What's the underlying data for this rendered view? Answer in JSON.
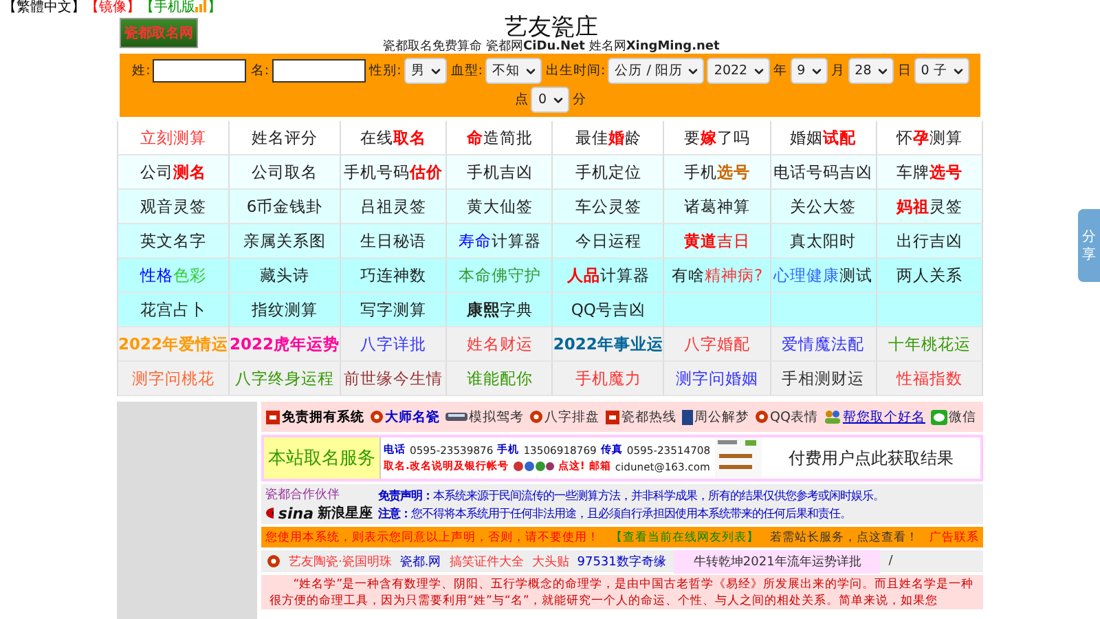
{
  "top_links": [
    {
      "text": "【繁體中文】",
      "color": "#000000"
    },
    {
      "text": "【镜像】",
      "color": "#ff0000"
    },
    {
      "text": "【手机版",
      "color": "#009900"
    },
    {
      "text": "】",
      "color": "#009900"
    }
  ],
  "logo": {
    "text": "瓷都取名网"
  },
  "header": {
    "title": "艺友瓷庄",
    "subtitle_parts": [
      {
        "text": "瓷都取名免费算命 瓷都网",
        "bold": false
      },
      {
        "text": "CiDu.Net",
        "bold": true
      },
      {
        "text": " 姓名网",
        "bold": false
      },
      {
        "text": "XingMing.net",
        "bold": true
      }
    ]
  },
  "form": {
    "fields": [
      {
        "kind": "input",
        "label": "姓:"
      },
      {
        "kind": "input",
        "label": "名:"
      },
      {
        "kind": "select",
        "label": "性别:",
        "value": "男"
      },
      {
        "kind": "select",
        "label": "血型:",
        "value": "不知"
      },
      {
        "kind": "select",
        "label": "出生时间:",
        "value": "公历 / 阳历"
      },
      {
        "kind": "select",
        "value": "2022"
      },
      {
        "kind": "unit",
        "label": "年"
      },
      {
        "kind": "select",
        "value": "9"
      },
      {
        "kind": "unit",
        "label": "月"
      },
      {
        "kind": "select",
        "value": "28"
      },
      {
        "kind": "unit",
        "label": "日"
      },
      {
        "kind": "select",
        "value": "0 子"
      }
    ],
    "second_row": [
      {
        "kind": "unit",
        "label": "点"
      },
      {
        "kind": "select",
        "value": "0"
      },
      {
        "kind": "unit",
        "label": "分"
      }
    ]
  },
  "grid": [
    [
      [
        {
          "text": "立刻测算",
          "color": "#ff3333"
        }
      ],
      [
        {
          "text": "姓名评分"
        }
      ],
      [
        {
          "text": "在线"
        },
        {
          "text": "取名",
          "color": "#ff0000",
          "bold": true
        }
      ],
      [
        {
          "text": "命",
          "color": "#ff0000",
          "bold": true
        },
        {
          "text": "造简批"
        }
      ],
      [
        {
          "text": "最佳"
        },
        {
          "text": "婚",
          "color": "#ff0000",
          "bold": true
        },
        {
          "text": "龄"
        }
      ],
      [
        {
          "text": "要"
        },
        {
          "text": "嫁",
          "color": "#ff0000",
          "bold": true
        },
        {
          "text": "了吗"
        }
      ],
      [
        {
          "text": "婚姻"
        },
        {
          "text": "试配",
          "color": "#ff0000",
          "bold": true
        }
      ],
      [
        {
          "text": "怀"
        },
        {
          "text": "孕",
          "color": "#ff0000",
          "bold": true
        },
        {
          "text": "测算"
        }
      ]
    ],
    [
      [
        {
          "text": "公司"
        },
        {
          "text": "测名",
          "color": "#ff0000",
          "bold": true
        }
      ],
      [
        {
          "text": "公司取名"
        }
      ],
      [
        {
          "text": "手机号码"
        },
        {
          "text": "估价",
          "color": "#ff0000",
          "bold": true
        }
      ],
      [
        {
          "text": "手机吉凶"
        }
      ],
      [
        {
          "text": "手机定位"
        }
      ],
      [
        {
          "text": "手机"
        },
        {
          "text": "选号",
          "color": "#cc6600",
          "bold": true
        }
      ],
      [
        {
          "text": "电话号码吉凶"
        }
      ],
      [
        {
          "text": "车牌"
        },
        {
          "text": "选号",
          "color": "#ff0000",
          "bold": true
        }
      ]
    ],
    [
      [
        {
          "text": "观音灵签"
        }
      ],
      [
        {
          "text": "6币金钱卦"
        }
      ],
      [
        {
          "text": "吕祖灵签"
        }
      ],
      [
        {
          "text": "黄大仙签"
        }
      ],
      [
        {
          "text": "车公灵签"
        }
      ],
      [
        {
          "text": "诸葛神算"
        }
      ],
      [
        {
          "text": "关公大签"
        }
      ],
      [
        {
          "text": "妈祖",
          "color": "#ff0000",
          "bold": true
        },
        {
          "text": "灵签"
        }
      ]
    ],
    [
      [
        {
          "text": "英文名字"
        }
      ],
      [
        {
          "text": "亲属关系图"
        }
      ],
      [
        {
          "text": "生日秘语"
        }
      ],
      [
        {
          "text": "寿命",
          "color": "#0000ff"
        },
        {
          "text": "计算器"
        }
      ],
      [
        {
          "text": "今日运程"
        }
      ],
      [
        {
          "text": "黄道",
          "color": "#ff0000",
          "bold": true
        },
        {
          "text": "吉日",
          "color": "#ff0000"
        }
      ],
      [
        {
          "text": "真太阳时"
        }
      ],
      [
        {
          "text": "出行吉凶"
        }
      ]
    ],
    [
      [
        {
          "text": "性格",
          "color": "#0000ff"
        },
        {
          "text": "色彩",
          "color": "#33cc33"
        }
      ],
      [
        {
          "text": "藏头诗"
        }
      ],
      [
        {
          "text": "巧连神数"
        }
      ],
      [
        {
          "text": "本命佛守护",
          "color": "#339933"
        }
      ],
      [
        {
          "text": "人品",
          "color": "#ff0000",
          "bold": true
        },
        {
          "text": "计算器"
        }
      ],
      [
        {
          "text": "有啥"
        },
        {
          "text": "精神病?",
          "color": "#ff3333"
        }
      ],
      [
        {
          "text": "心理健康",
          "color": "#3366ff"
        },
        {
          "text": "测试"
        }
      ],
      [
        {
          "text": "两人关系"
        }
      ]
    ],
    [
      [
        {
          "text": "花宫占卜"
        }
      ],
      [
        {
          "text": "指纹测算"
        }
      ],
      [
        {
          "text": "写字测算"
        }
      ],
      [
        {
          "text": "康熙",
          "bold": true
        },
        {
          "text": "字典"
        }
      ],
      [
        {
          "text": "QQ号吉凶"
        }
      ]
    ],
    [
      [
        {
          "text": "2022年爱情运",
          "color": "#ff9900",
          "bold": true
        }
      ],
      [
        {
          "text": "2022虎年运势",
          "color": "#ff0099",
          "bold": true
        }
      ],
      [
        {
          "text": "八字详批",
          "color": "#3333ff"
        }
      ],
      [
        {
          "text": "姓名财运",
          "color": "#ff3333"
        }
      ],
      [
        {
          "text": "2022年事业运",
          "color": "#006699",
          "bold": true
        }
      ],
      [
        {
          "text": "八字婚配",
          "color": "#ff3333"
        }
      ],
      [
        {
          "text": "爱情魔法配",
          "color": "#3333ff"
        }
      ],
      [
        {
          "text": "十年桃花运",
          "color": "#339900"
        }
      ]
    ],
    [
      [
        {
          "text": "测字问桃花",
          "color": "#ff6633"
        }
      ],
      [
        {
          "text": "八字终身运程",
          "color": "#339900"
        }
      ],
      [
        {
          "text": "前世缘今生情",
          "color": "#993333"
        }
      ],
      [
        {
          "text": "谁能配你",
          "color": "#339900"
        }
      ],
      [
        {
          "text": "手机魔力",
          "color": "#ff3333"
        }
      ],
      [
        {
          "text": "测字问婚姻",
          "color": "#3333ff"
        }
      ],
      [
        {
          "text": "手相测财运",
          "color": "#333333"
        }
      ],
      [
        {
          "text": "性福指数",
          "color": "#ff3333"
        }
      ]
    ]
  ],
  "links_bar": [
    {
      "text": "免责拥有系统",
      "bold": true,
      "color": "#000000",
      "kind": "box"
    },
    {
      "text": "大师名瓷",
      "bold": true,
      "color": "#0000cc",
      "kind": "circle"
    },
    {
      "text": "模拟驾考",
      "bold": false,
      "color": "#333333",
      "kind": "bus"
    },
    {
      "text": "八字排盘",
      "bold": false,
      "color": "#333333",
      "kind": "circle"
    },
    {
      "text": "瓷都热线",
      "bold": false,
      "color": "#333333",
      "kind": "box"
    },
    {
      "text": "周公解梦",
      "bold": false,
      "color": "#333333",
      "kind": "book"
    },
    {
      "text": "QQ表情",
      "bold": false,
      "color": "#333333",
      "kind": "circle"
    },
    {
      "text": "帮您取个好名",
      "bold": false,
      "color": "#0000cc",
      "kind": "people"
    },
    {
      "text": "微信",
      "bold": false,
      "color": "#333333",
      "kind": "chat"
    }
  ],
  "service": {
    "title": "本站取名服务",
    "contact": [
      {
        "label": "电话",
        "value": "0595-23539876"
      },
      {
        "label": "手机",
        "value": "13506918769"
      },
      {
        "label": "传真",
        "value": "0595-23514708"
      }
    ],
    "notice": "取名.改名说明及银行帐号",
    "action": "点这!",
    "email_label": "邮箱",
    "email": "cidunet@163.com",
    "result_link": "付费用户点此获取结果"
  },
  "partner": {
    "tagline": "瓷都合作伙伴",
    "brand": "sina",
    "brand_name": "新浪星座",
    "statements": [
      {
        "label": "免责声明：",
        "text": "本系统来源于民间流传的一些测算方法，并非科学成果，所有的结果仅供您参考或闲时娱乐。"
      },
      {
        "label": "注意：",
        "text": "您不得将本系统用于任何非法用途，且必须自行承担因使用本系统带来的任何后果和责任。"
      }
    ]
  },
  "agreement_bar": [
    {
      "text": "您使用本系统，则表示您同意以上声明，否则，请不要使用！",
      "color": "#ff0000"
    },
    {
      "text": "【查看当前在线网友列表】",
      "color": "#008800"
    },
    {
      "text": "若需站长服务，点这查看！",
      "color": "#333333"
    },
    {
      "text": "广告联系",
      "color": "#ff0000"
    }
  ],
  "friend_links": [
    {
      "text": "艺友陶瓷·瓷国明珠",
      "color": "#ff3333",
      "highlighted": false
    },
    {
      "text": "瓷都.网",
      "color": "#0000cc",
      "highlighted": false
    },
    {
      "text": "搞笑证件大全",
      "color": "#ff3333",
      "highlighted": false
    },
    {
      "text": "大头贴",
      "color": "#ff3333",
      "highlighted": false
    },
    {
      "text": "97531数字奇缘",
      "color": "#0000cc",
      "highlighted": false
    },
    {
      "text": "牛转乾坤2021年流年运势详批",
      "color": "#333333",
      "highlighted": true
    },
    {
      "text": "/",
      "color": "#333333",
      "highlighted": false
    }
  ],
  "intro": "“姓名学”是一种含有数理学、阴阳、五行学概念的命理学，是由中国古老哲学《易经》所发展出来的学问。而且姓名学是一种很方便的命理工具，因为只需要利用“姓”与“名”，就能研究一个人的命运、个性、与人之间的相处关系。简单来说，如果您",
  "share": {
    "text": "分享"
  }
}
